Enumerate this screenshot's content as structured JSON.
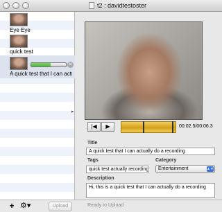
{
  "window": {
    "title": "t2 : davidtestoster"
  },
  "sidebar": {
    "items": [
      {
        "label": "Eye Eye"
      },
      {
        "label": "quick test"
      },
      {
        "label": "A quick test that I can actually",
        "progress": 0.55
      }
    ]
  },
  "bottom": {
    "add_label": "+",
    "gear_label": "⚙▾",
    "upload_label": "Upload",
    "status": "Ready to Upload"
  },
  "player": {
    "rewind_label": "|◀",
    "play_label": "▶",
    "time": "00:02.5/00:06.3",
    "position": 0.4,
    "selection_end": 0.93
  },
  "form": {
    "title_label": "Title",
    "title_value": "A quick test that I can actually do a recording",
    "tags_label": "Tags",
    "tags_value": "quick test actually recording",
    "category_label": "Category",
    "category_value": "Entertainment",
    "description_label": "Description",
    "description_value": "Hi, this is a quick test that I can actually do a recording"
  },
  "colors": {
    "progress": "#4fb13d",
    "scrubber": "#d9a724",
    "select_arrows": "#3a72d8"
  }
}
